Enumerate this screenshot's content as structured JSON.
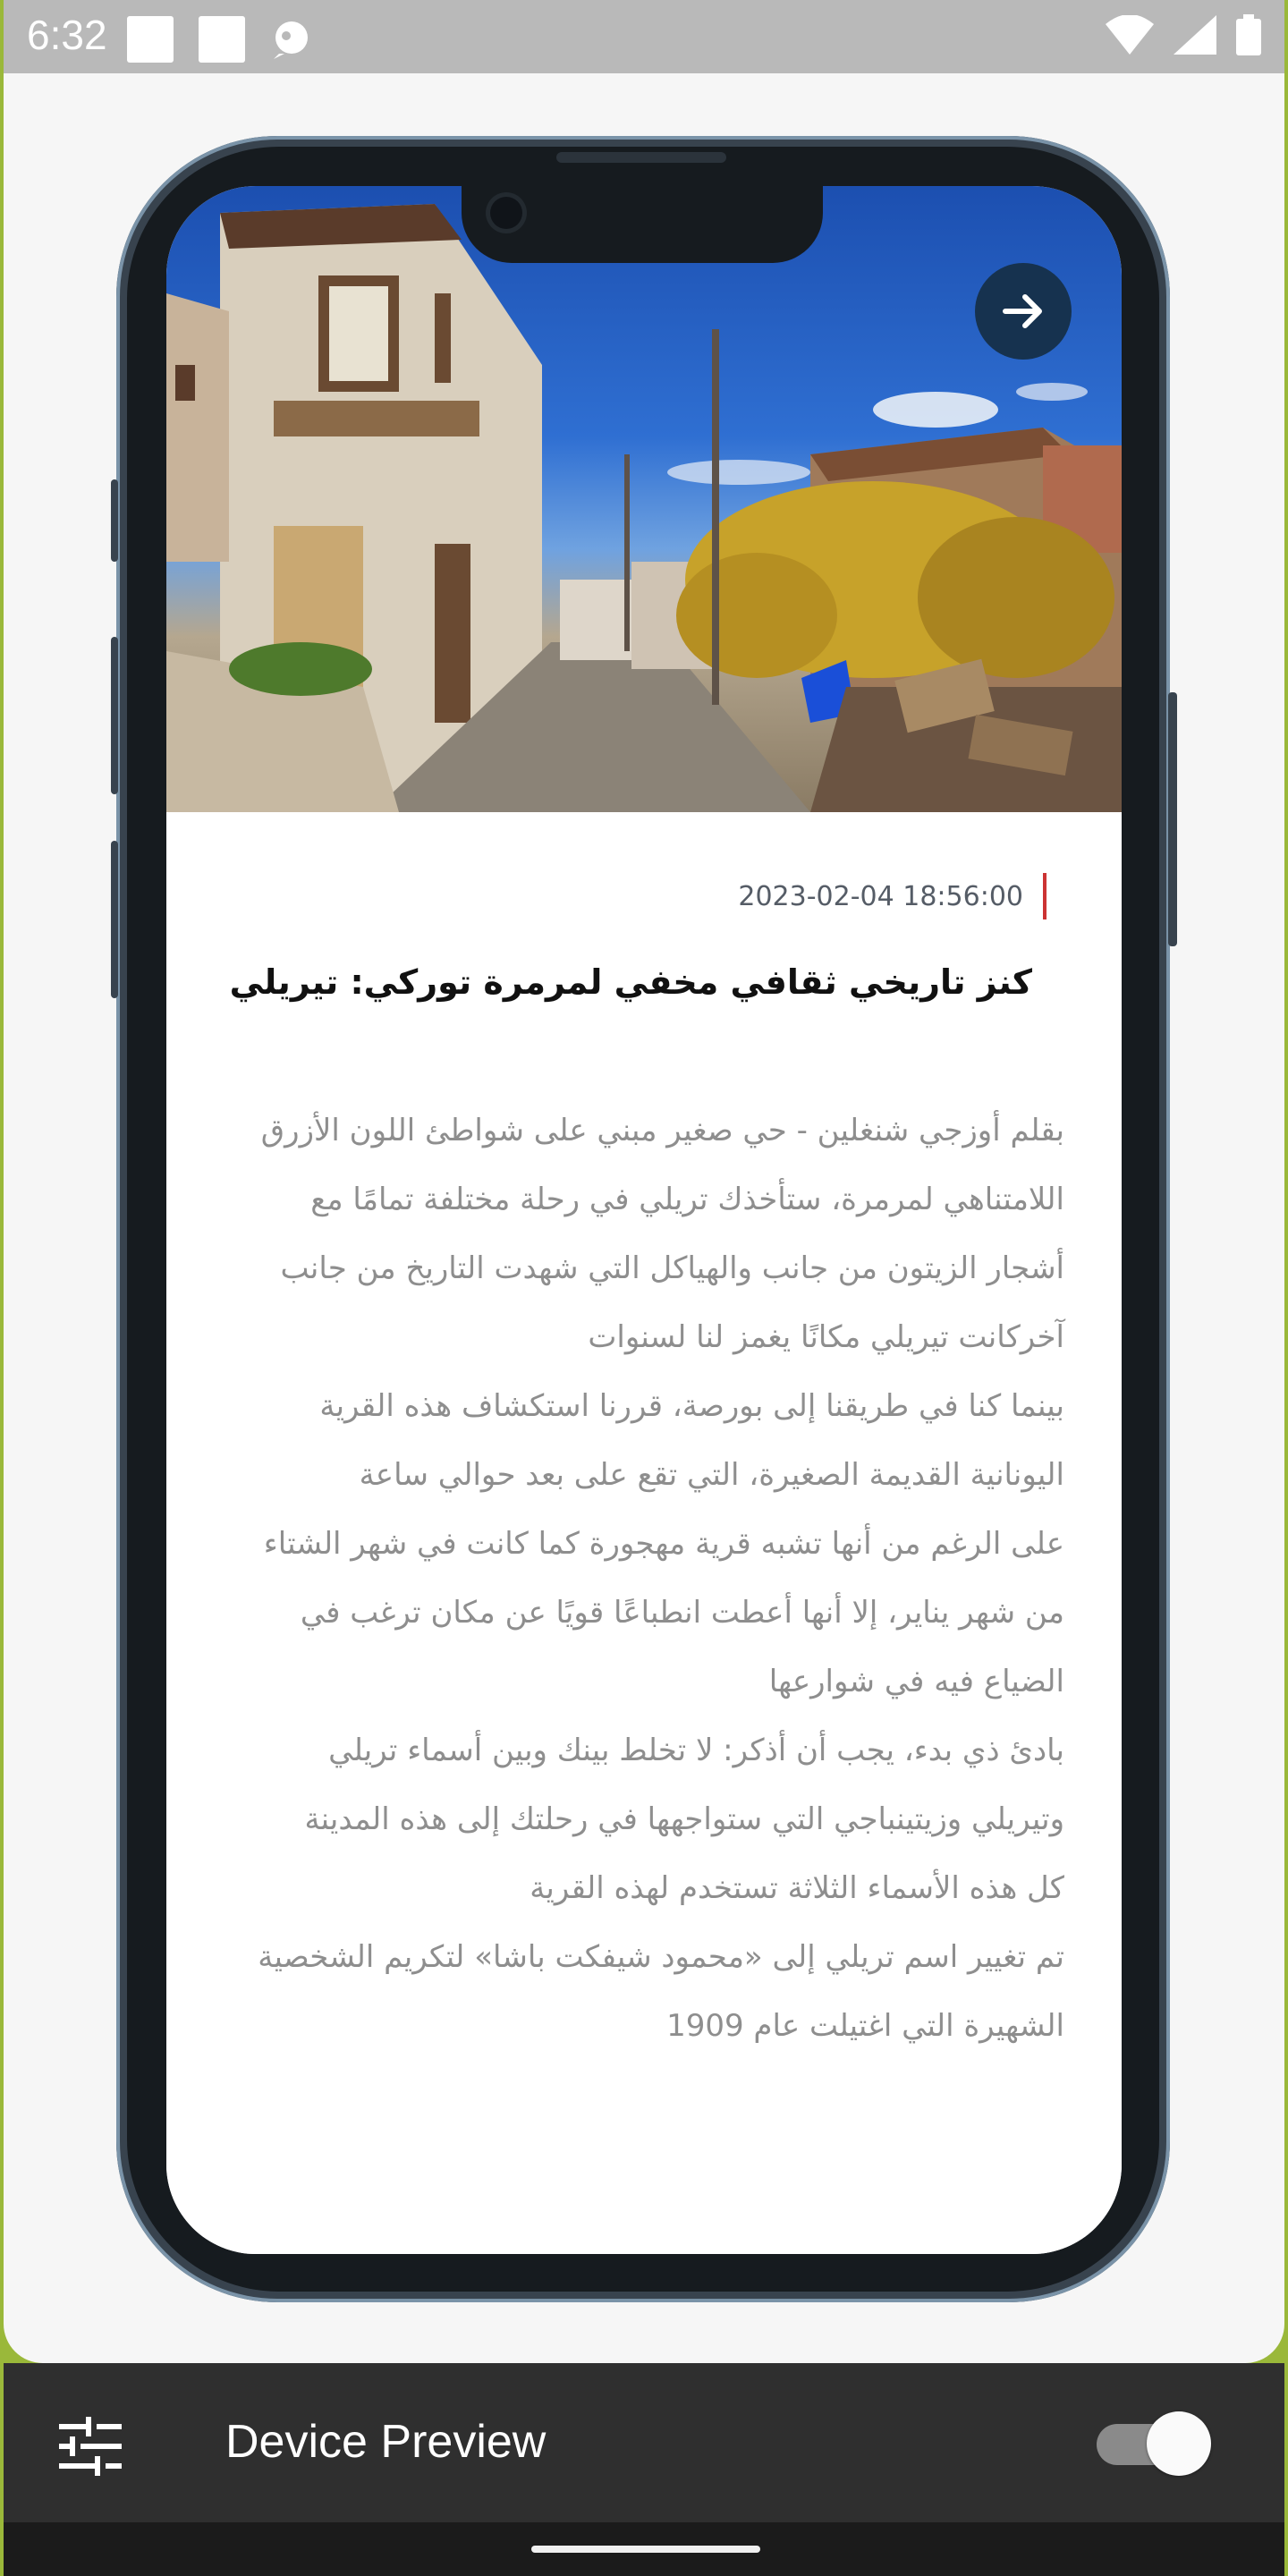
{
  "status_bar": {
    "time": "6:32",
    "icons": [
      "notification-square-icon",
      "notification-square-icon",
      "debug-icon",
      "wifi-icon",
      "signal-icon",
      "battery-icon"
    ]
  },
  "article": {
    "date": "2023-02-04 18:56:00",
    "title": "كنز تاريخي ثقافي مخفي لمرمرة توركي: تيريلي",
    "paragraphs": [
      "بقلم أوزجي شنغلين - حي صغير مبني على شواطئ اللون الأزرق اللامتناهي لمرمرة، ستأخذك تريلي في رحلة مختلفة تمامًا مع أشجار الزيتون من جانب والهياكل التي شهدت التاريخ من جانب آخركانت تيريلي مكانًا يغمز لنا لسنوات",
      "بينما كنا في طريقنا إلى بورصة، قررنا استكشاف هذه القرية اليونانية القديمة الصغيرة، التي تقع على بعد حوالي ساعة",
      "على الرغم من أنها تشبه قرية مهجورة كما كانت في شهر الشتاء من شهر يناير، إلا أنها أعطت انطباعًا قويًا عن مكان ترغب في الضياع فيه في شوارعها",
      "بادئ ذي بدء، يجب أن أذكر: لا تخلط بينك وبين أسماء تريلي وتيريلي وزيتينباجي التي ستواجهها في رحلتك إلى هذه المدينة",
      "كل هذه الأسماء الثلاثة تستخدم لهذه القرية",
      "تم تغيير اسم تريلي إلى «محمود شيفكت باشا» لتكريم الشخصية الشهيرة التي اغتيلت عام 1909"
    ],
    "next_icon": "arrow-right-icon",
    "accent_color": "#cc3333"
  },
  "preview_bar": {
    "label": "Device Preview",
    "settings_icon": "tune-icon",
    "toggle_on": true
  },
  "colors": {
    "frame": "#38434e",
    "bezel": "#161b1f",
    "next_button": "#16324f",
    "bar": "#2f2f2f"
  }
}
